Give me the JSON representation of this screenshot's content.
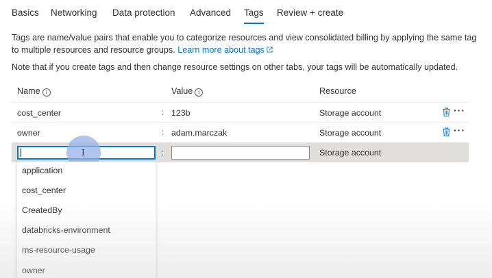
{
  "tabs": [
    {
      "label": "Basics"
    },
    {
      "label": "Networking"
    },
    {
      "label": "Data protection"
    },
    {
      "label": "Advanced"
    },
    {
      "label": "Tags"
    },
    {
      "label": "Review + create"
    }
  ],
  "active_tab": "Tags",
  "description": {
    "text": "Tags are name/value pairs that enable you to categorize resources and view consolidated billing by applying the same tag to multiple resources and resource groups.",
    "link": "Learn more about tags"
  },
  "note": "Note that if you create tags and then change resource settings on other tabs, your tags will be automatically updated.",
  "table": {
    "headers": {
      "name": "Name",
      "value": "Value",
      "resource": "Resource"
    },
    "separator": ":",
    "rows": [
      {
        "name": "cost_center",
        "value": "123b",
        "resource": "Storage account"
      },
      {
        "name": "owner",
        "value": "adam.marczak",
        "resource": "Storage account"
      }
    ],
    "edit_row": {
      "name": "",
      "value": "",
      "resource": "Storage account"
    }
  },
  "dropdown_options": [
    "application",
    "cost_center",
    "CreatedBy",
    "databricks-environment",
    "ms-resource-usage",
    "owner"
  ],
  "icons": {
    "info": "info-icon",
    "delete": "trash-icon",
    "more": "more-icon",
    "external": "external-link-icon"
  },
  "colors": {
    "accent": "#0078d4",
    "row_highlight": "#e1dfdd"
  }
}
